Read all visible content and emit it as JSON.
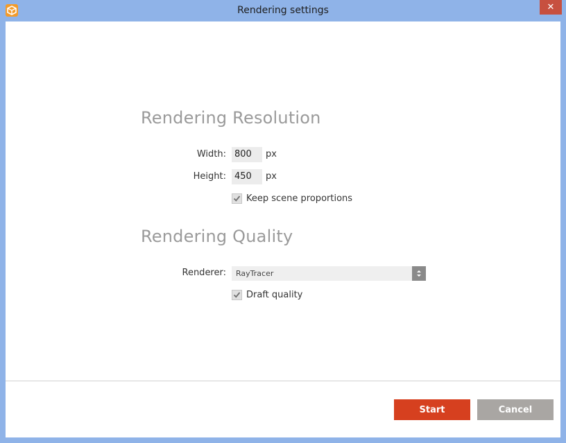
{
  "window": {
    "title": "Rendering settings",
    "close_symbol": "✕",
    "app_icon": "app-cube-icon"
  },
  "resolution": {
    "heading": "Rendering Resolution",
    "width_label": "Width:",
    "width_value": "800",
    "width_unit": "px",
    "height_label": "Height:",
    "height_value": "450",
    "height_unit": "px",
    "keep_proportions_label": "Keep scene proportions",
    "keep_proportions_checked": true
  },
  "quality": {
    "heading": "Rendering Quality",
    "renderer_label": "Renderer:",
    "renderer_value": "RayTracer",
    "draft_label": "Draft quality",
    "draft_checked": true
  },
  "actions": {
    "start_label": "Start",
    "cancel_label": "Cancel"
  },
  "colors": {
    "frame": "#8fb3e8",
    "accent_start": "#d6401f",
    "cancel_gray": "#a9a6a3",
    "heading_gray": "#9a9a9a"
  }
}
